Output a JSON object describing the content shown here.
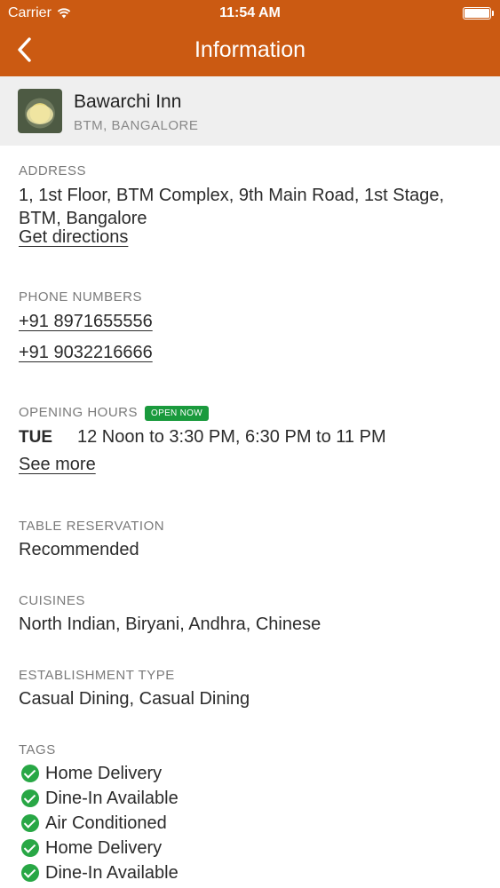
{
  "status_bar": {
    "carrier": "Carrier",
    "time": "11:54 AM"
  },
  "nav": {
    "title": "Information",
    "back_icon": "chevron-left-icon"
  },
  "restaurant": {
    "name": "Bawarchi Inn",
    "location": "BTM, BANGALORE"
  },
  "address": {
    "label": "ADDRESS",
    "line1": "1, 1st Floor, BTM Complex, 9th Main Road, 1st Stage,",
    "line2": "BTM, Bangalore",
    "directions": "Get directions"
  },
  "phones": {
    "label": "PHONE NUMBERS",
    "numbers": [
      "+91 8971655556",
      "+91 9032216666"
    ]
  },
  "hours": {
    "label": "OPENING HOURS",
    "badge": "OPEN NOW",
    "day": "TUE",
    "times": "12 Noon to 3:30 PM, 6:30 PM to 11 PM",
    "see_more": "See more"
  },
  "reservation": {
    "label": "TABLE RESERVATION",
    "value": "Recommended"
  },
  "cuisines": {
    "label": "CUISINES",
    "value": "North Indian, Biryani, Andhra, Chinese"
  },
  "establishment": {
    "label": "ESTABLISHMENT TYPE",
    "value": "Casual Dining, Casual Dining"
  },
  "tags": {
    "label": "TAGS",
    "items": [
      "Home Delivery",
      "Dine-In Available",
      "Air Conditioned",
      "Home Delivery",
      "Dine-In Available"
    ]
  },
  "colors": {
    "nav": "#cb5a12",
    "open_badge": "#1a9a3d",
    "check": "#28a745"
  }
}
